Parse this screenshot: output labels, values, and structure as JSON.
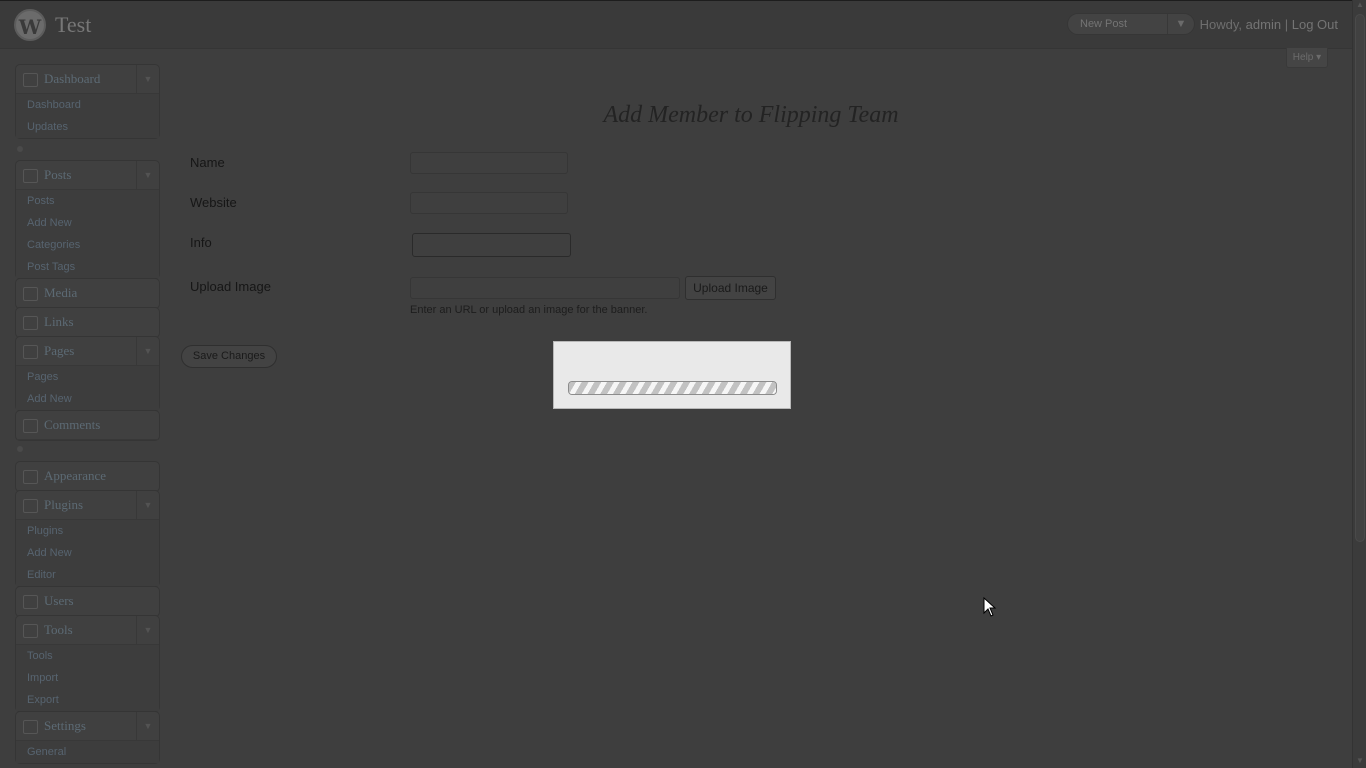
{
  "header": {
    "logo": "W",
    "site_title": "Test",
    "favorite_actions": "New Post",
    "howdy": "Howdy,",
    "username": "admin",
    "separator": "|",
    "logout": "Log Out"
  },
  "help_tab": "Help",
  "sidebar": {
    "dashboard": {
      "label": "Dashboard",
      "items": [
        "Dashboard",
        "Updates"
      ]
    },
    "posts": {
      "label": "Posts",
      "items": [
        "Posts",
        "Add New",
        "Categories",
        "Post Tags"
      ]
    },
    "media": {
      "label": "Media"
    },
    "links": {
      "label": "Links"
    },
    "pages": {
      "label": "Pages",
      "items": [
        "Pages",
        "Add New"
      ]
    },
    "comments": {
      "label": "Comments"
    },
    "appearance": {
      "label": "Appearance"
    },
    "plugins": {
      "label": "Plugins",
      "items": [
        "Plugins",
        "Add New",
        "Editor"
      ]
    },
    "users": {
      "label": "Users"
    },
    "tools": {
      "label": "Tools",
      "items": [
        "Tools",
        "Import",
        "Export"
      ]
    },
    "settings": {
      "label": "Settings",
      "items": [
        "General"
      ]
    }
  },
  "main": {
    "title": "Add Member to Flipping Team",
    "fields": {
      "name": {
        "label": "Name",
        "value": ""
      },
      "website": {
        "label": "Website",
        "value": ""
      },
      "info": {
        "label": "Info",
        "value": ""
      },
      "upload_image": {
        "label": "Upload Image",
        "value": "",
        "button": "Upload Image",
        "description": "Enter an URL or upload an image for the banner."
      }
    },
    "save_button": "Save Changes"
  },
  "loading_dialog": {
    "progress": 1.0
  }
}
